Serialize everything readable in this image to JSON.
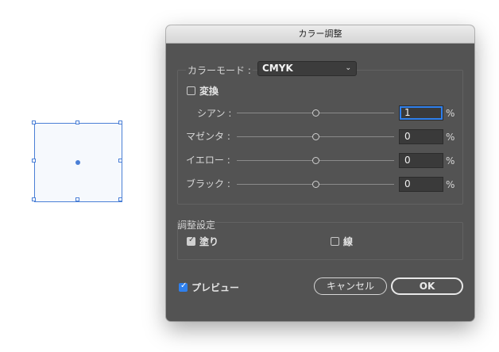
{
  "dialog": {
    "title": "カラー調整",
    "color_mode": {
      "label": "カラーモード :",
      "value": "CMYK"
    },
    "convert": {
      "label": "変換",
      "checked": false
    },
    "channels": [
      {
        "label": "シアン :",
        "value": "1",
        "unit": "%"
      },
      {
        "label": "マゼンタ :",
        "value": "0",
        "unit": "%"
      },
      {
        "label": "イエロー :",
        "value": "0",
        "unit": "%"
      },
      {
        "label": "ブラック :",
        "value": "0",
        "unit": "%"
      }
    ],
    "adjust_settings": {
      "label": "調整設定",
      "fill": {
        "label": "塗り",
        "checked": true
      },
      "stroke": {
        "label": "線",
        "checked": false
      }
    },
    "preview": {
      "label": "プレビュー",
      "checked": true
    },
    "cancel_label": "キャンセル",
    "ok_label": "OK"
  },
  "colors": {
    "dialog_bg": "#535353",
    "accent": "#2f80ed",
    "selection": "#4a7fd6"
  }
}
